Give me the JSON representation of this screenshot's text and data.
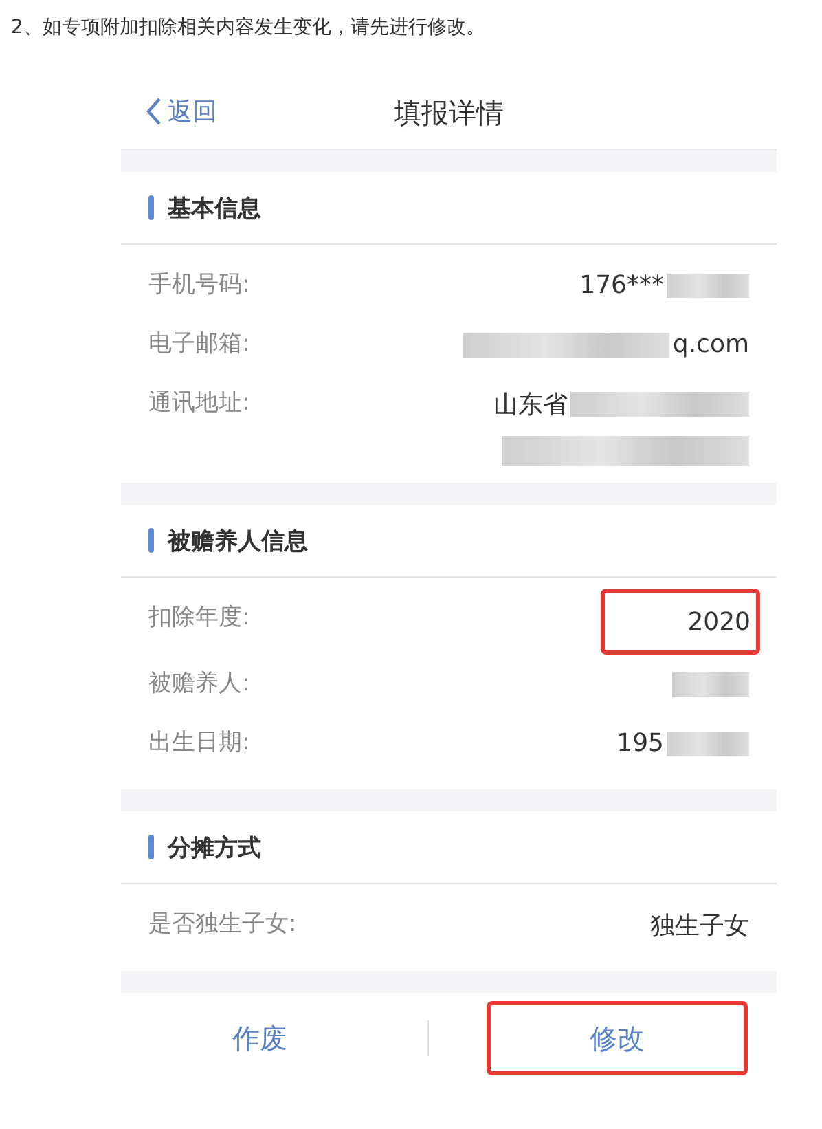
{
  "caption": "2、如专项附加扣除相关内容发生变化，请先进行修改。",
  "nav": {
    "back": "返回",
    "title": "填报详情"
  },
  "sections": [
    {
      "title": "基本信息",
      "rows": [
        {
          "label": "手机号码:",
          "value": "176***",
          "blur_before": false,
          "blur_after": true,
          "blur_second_line": false,
          "highlighted": false
        },
        {
          "label": "电子邮箱:",
          "value": "q.com",
          "blur_before": true,
          "blur_after": false,
          "blur_second_line": false,
          "highlighted": false
        },
        {
          "label": "通讯地址:",
          "value": "山东省",
          "blur_before": false,
          "blur_after": true,
          "blur_second_line": true,
          "highlighted": false
        }
      ]
    },
    {
      "title": "被赡养人信息",
      "rows": [
        {
          "label": "扣除年度:",
          "value": "2020",
          "blur_before": false,
          "blur_after": false,
          "blur_second_line": false,
          "highlighted": true
        },
        {
          "label": "被赡养人:",
          "blur_before": true,
          "blur_after": false,
          "blur_second_line": false,
          "highlighted": false
        },
        {
          "label": "出生日期:",
          "value": "195",
          "blur_before": false,
          "blur_after": true,
          "blur_second_line": false,
          "highlighted": false
        }
      ]
    },
    {
      "title": "分摊方式",
      "rows": [
        {
          "label": "是否独生子女:",
          "value": "独生子女",
          "blur_before": false,
          "blur_after": false,
          "blur_second_line": false,
          "highlighted": false
        }
      ]
    }
  ],
  "actions": [
    {
      "label": "作废",
      "highlighted": false
    },
    {
      "label": "修改",
      "highlighted": true
    }
  ]
}
